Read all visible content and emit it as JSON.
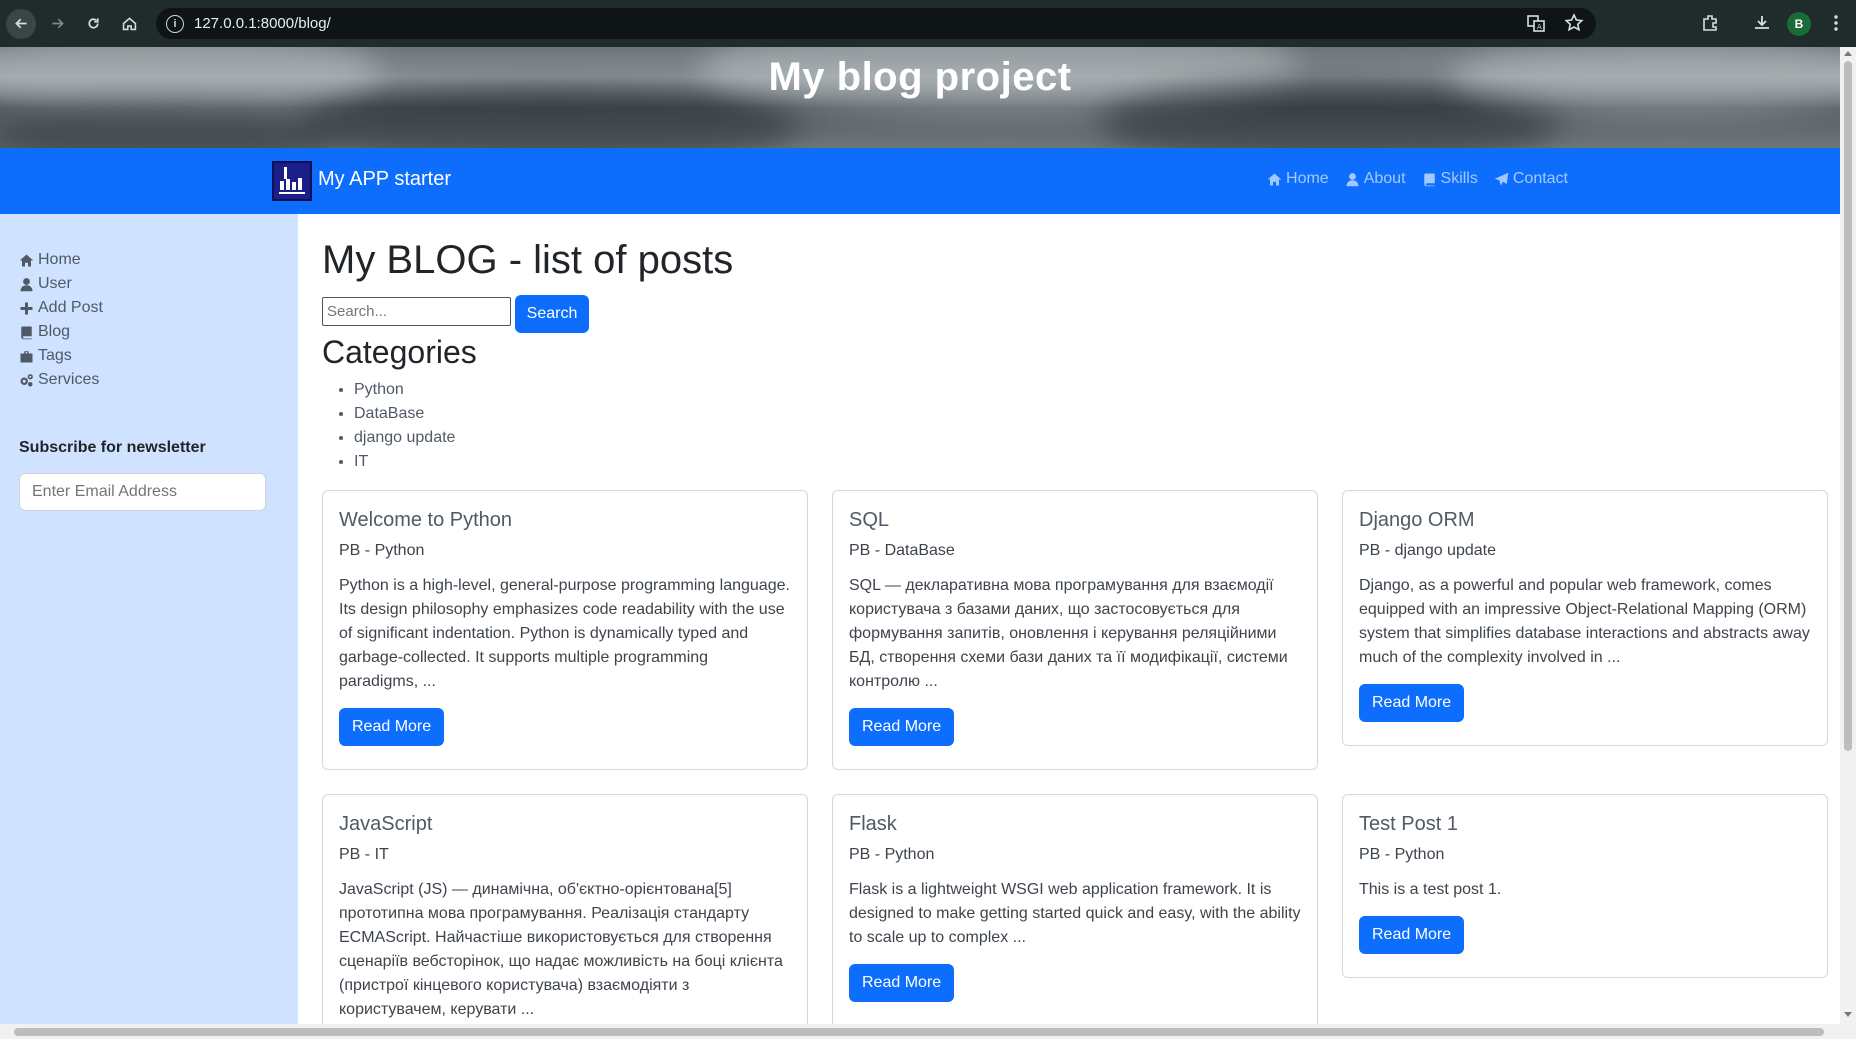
{
  "browser": {
    "url": "127.0.0.1:8000/blog/",
    "profile_initial": "B"
  },
  "hero": {
    "title": "My blog project"
  },
  "navbar": {
    "brand": "My APP starter",
    "links": [
      {
        "label": "Home",
        "icon": "home-icon"
      },
      {
        "label": "About",
        "icon": "user-icon"
      },
      {
        "label": "Skills",
        "icon": "book-icon"
      },
      {
        "label": "Contact",
        "icon": "paper-plane-icon"
      }
    ]
  },
  "sidebar": {
    "items": [
      {
        "label": "Home",
        "icon": "home-icon"
      },
      {
        "label": "User",
        "icon": "user-icon"
      },
      {
        "label": "Add Post",
        "icon": "plus-icon"
      },
      {
        "label": "Blog",
        "icon": "book-icon"
      },
      {
        "label": "Tags",
        "icon": "briefcase-icon"
      },
      {
        "label": "Services",
        "icon": "gears-icon"
      }
    ],
    "newsletter_title": "Subscribe for newsletter",
    "email_placeholder": "Enter Email Address"
  },
  "main": {
    "title": "My BLOG - list of posts",
    "search_placeholder": "Search...",
    "search_button": "Search",
    "categories_title": "Categories",
    "categories": [
      "Python",
      "DataBase",
      "django update",
      "IT"
    ],
    "read_more": "Read More",
    "posts": [
      {
        "title": "Welcome to Python",
        "meta": "PB - Python",
        "excerpt": "Python is a high-level, general-purpose programming language. Its design philosophy emphasizes code readability with the use of significant indentation. Python is dynamically typed and garbage-collected. It supports multiple programming paradigms, ..."
      },
      {
        "title": "SQL",
        "meta": "PB - DataBase",
        "excerpt": "SQL — декларативна мова програмування для взаємодії користувача з базами даних, що застосовується для формування запитів, оновлення і керування реляційними БД, створення схеми бази даних та її модифікації, системи контролю ..."
      },
      {
        "title": "Django ORM",
        "meta": "PB - django update",
        "excerpt": "Django, as a powerful and popular web framework, comes equipped with an impressive Object-Relational Mapping (ORM) system that simplifies database interactions and abstracts away much of the complexity involved in ..."
      },
      {
        "title": "JavaScript",
        "meta": "PB - IT",
        "excerpt": "JavaScript (JS) — динамічна, об'єктно-орієнтована[5] прототипна мова програмування. Реалізація стандарту ECMAScript. Найчастіше використовується для створення сценаріїв вебсторінок, що надає можливість на боці клієнта (пристрої кінцевого користувача) взаємодіяти з користувачем, керувати ..."
      },
      {
        "title": "Flask",
        "meta": "PB - Python",
        "excerpt": "Flask is a lightweight WSGI web application framework. It is designed to make getting started quick and easy, with the ability to scale up to complex ..."
      },
      {
        "title": "Test Post 1",
        "meta": "PB - Python",
        "excerpt": "This is a test post 1."
      }
    ]
  },
  "colors": {
    "primary": "#0d6efd",
    "sidebar_bg": "#cfe2ff",
    "chrome_bg": "#202b2b"
  }
}
